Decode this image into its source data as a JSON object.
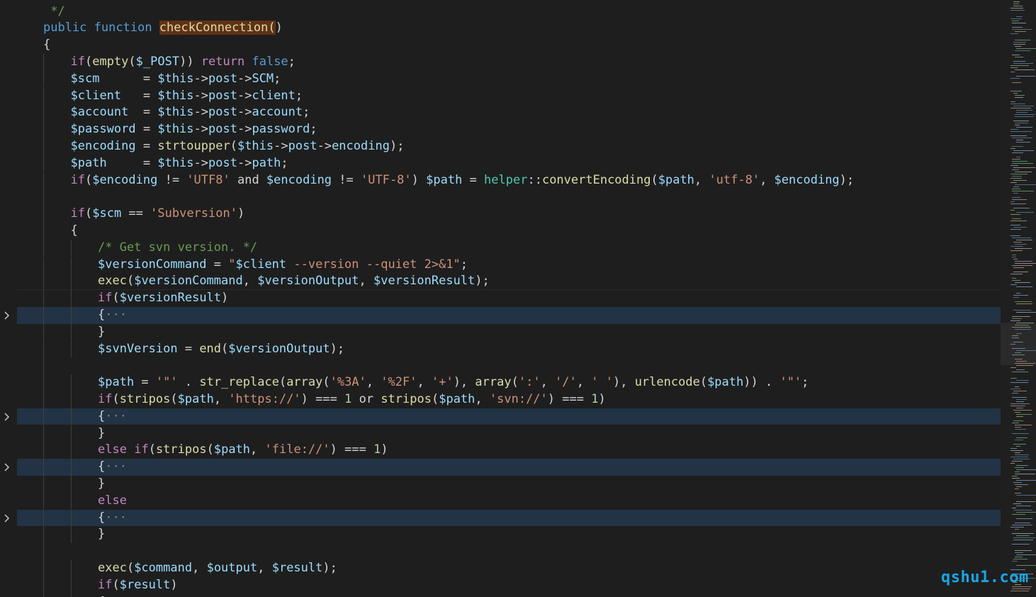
{
  "editor": {
    "language": "php",
    "colors": {
      "background": "#1e1e1e",
      "folded_line_bg": "#213344",
      "keyword": "#569cd6",
      "control": "#c586c0",
      "variable": "#9cdcfe",
      "function": "#dcdcaa",
      "string": "#ce9178",
      "comment": "#6a9955",
      "number": "#b5cea8",
      "class": "#4ec9b0"
    },
    "lines": [
      {
        "indent": 1,
        "tokens": [
          [
            "cmt",
            " */"
          ]
        ]
      },
      {
        "indent": 1,
        "tokens": [
          [
            "kw",
            "public"
          ],
          [
            "op",
            " "
          ],
          [
            "kw",
            "function"
          ],
          [
            "op",
            " "
          ],
          [
            "hlfn",
            "checkConnection("
          ],
          [
            "punc",
            ")"
          ]
        ]
      },
      {
        "indent": 1,
        "tokens": [
          [
            "punc",
            "{"
          ]
        ]
      },
      {
        "indent": 2,
        "tokens": [
          [
            "ctl",
            "if"
          ],
          [
            "punc",
            "("
          ],
          [
            "fn",
            "empty"
          ],
          [
            "punc",
            "("
          ],
          [
            "var",
            "$_POST"
          ],
          [
            "punc",
            ")) "
          ],
          [
            "ctl",
            "return"
          ],
          [
            "op",
            " "
          ],
          [
            "kw",
            "false"
          ],
          [
            "punc",
            ";"
          ]
        ]
      },
      {
        "indent": 2,
        "tokens": [
          [
            "var",
            "$scm"
          ],
          [
            "op",
            "      = "
          ],
          [
            "var",
            "$this"
          ],
          [
            "op",
            "->"
          ],
          [
            "var",
            "post"
          ],
          [
            "op",
            "->"
          ],
          [
            "var",
            "SCM"
          ],
          [
            "punc",
            ";"
          ]
        ]
      },
      {
        "indent": 2,
        "tokens": [
          [
            "var",
            "$client"
          ],
          [
            "op",
            "   = "
          ],
          [
            "var",
            "$this"
          ],
          [
            "op",
            "->"
          ],
          [
            "var",
            "post"
          ],
          [
            "op",
            "->"
          ],
          [
            "var",
            "client"
          ],
          [
            "punc",
            ";"
          ]
        ]
      },
      {
        "indent": 2,
        "tokens": [
          [
            "var",
            "$account"
          ],
          [
            "op",
            "  = "
          ],
          [
            "var",
            "$this"
          ],
          [
            "op",
            "->"
          ],
          [
            "var",
            "post"
          ],
          [
            "op",
            "->"
          ],
          [
            "var",
            "account"
          ],
          [
            "punc",
            ";"
          ]
        ]
      },
      {
        "indent": 2,
        "tokens": [
          [
            "var",
            "$password"
          ],
          [
            "op",
            " = "
          ],
          [
            "var",
            "$this"
          ],
          [
            "op",
            "->"
          ],
          [
            "var",
            "post"
          ],
          [
            "op",
            "->"
          ],
          [
            "var",
            "password"
          ],
          [
            "punc",
            ";"
          ]
        ]
      },
      {
        "indent": 2,
        "tokens": [
          [
            "var",
            "$encoding"
          ],
          [
            "op",
            " = "
          ],
          [
            "fn",
            "strtoupper"
          ],
          [
            "punc",
            "("
          ],
          [
            "var",
            "$this"
          ],
          [
            "op",
            "->"
          ],
          [
            "var",
            "post"
          ],
          [
            "op",
            "->"
          ],
          [
            "var",
            "encoding"
          ],
          [
            "punc",
            ");"
          ]
        ]
      },
      {
        "indent": 2,
        "tokens": [
          [
            "var",
            "$path"
          ],
          [
            "op",
            "     = "
          ],
          [
            "var",
            "$this"
          ],
          [
            "op",
            "->"
          ],
          [
            "var",
            "post"
          ],
          [
            "op",
            "->"
          ],
          [
            "var",
            "path"
          ],
          [
            "punc",
            ";"
          ]
        ]
      },
      {
        "indent": 2,
        "tokens": [
          [
            "ctl",
            "if"
          ],
          [
            "punc",
            "("
          ],
          [
            "var",
            "$encoding"
          ],
          [
            "op",
            " != "
          ],
          [
            "str",
            "'UTF8'"
          ],
          [
            "op",
            " and "
          ],
          [
            "var",
            "$encoding"
          ],
          [
            "op",
            " != "
          ],
          [
            "str",
            "'UTF-8'"
          ],
          [
            "punc",
            ") "
          ],
          [
            "var",
            "$path"
          ],
          [
            "op",
            " = "
          ],
          [
            "cls",
            "helper"
          ],
          [
            "op",
            "::"
          ],
          [
            "fn",
            "convertEncoding"
          ],
          [
            "punc",
            "("
          ],
          [
            "var",
            "$path"
          ],
          [
            "punc",
            ", "
          ],
          [
            "str",
            "'utf-8'"
          ],
          [
            "punc",
            ", "
          ],
          [
            "var",
            "$encoding"
          ],
          [
            "punc",
            ");"
          ]
        ]
      },
      {
        "indent": 2,
        "tokens": []
      },
      {
        "indent": 2,
        "tokens": [
          [
            "ctl",
            "if"
          ],
          [
            "punc",
            "("
          ],
          [
            "var",
            "$scm"
          ],
          [
            "op",
            " == "
          ],
          [
            "str",
            "'Subversion'"
          ],
          [
            "punc",
            ")"
          ]
        ]
      },
      {
        "indent": 2,
        "tokens": [
          [
            "punc",
            "{"
          ]
        ]
      },
      {
        "indent": 3,
        "tokens": [
          [
            "cmt",
            "/* Get svn version. */"
          ]
        ]
      },
      {
        "indent": 3,
        "tokens": [
          [
            "var",
            "$versionCommand"
          ],
          [
            "op",
            " = "
          ],
          [
            "str",
            "\""
          ],
          [
            "var",
            "$client"
          ],
          [
            "str",
            " --version --quiet 2>&1\""
          ],
          [
            "punc",
            ";"
          ]
        ]
      },
      {
        "indent": 3,
        "tokens": [
          [
            "fn",
            "exec"
          ],
          [
            "punc",
            "("
          ],
          [
            "var",
            "$versionCommand"
          ],
          [
            "punc",
            ", "
          ],
          [
            "var",
            "$versionOutput"
          ],
          [
            "punc",
            ", "
          ],
          [
            "var",
            "$versionResult"
          ],
          [
            "punc",
            ");"
          ]
        ]
      },
      {
        "indent": 3,
        "tokens": [
          [
            "ctl",
            "if"
          ],
          [
            "punc",
            "("
          ],
          [
            "var",
            "$versionResult"
          ],
          [
            "punc",
            ")"
          ]
        ]
      },
      {
        "indent": 3,
        "folded": true,
        "tokens": [
          [
            "punc",
            "{"
          ],
          [
            "fold",
            "···"
          ]
        ]
      },
      {
        "indent": 3,
        "tokens": [
          [
            "punc",
            "}"
          ]
        ]
      },
      {
        "indent": 3,
        "tokens": [
          [
            "var",
            "$svnVersion"
          ],
          [
            "op",
            " = "
          ],
          [
            "fn",
            "end"
          ],
          [
            "punc",
            "("
          ],
          [
            "var",
            "$versionOutput"
          ],
          [
            "punc",
            ");"
          ]
        ]
      },
      {
        "indent": 3,
        "tokens": []
      },
      {
        "indent": 3,
        "tokens": [
          [
            "var",
            "$path"
          ],
          [
            "op",
            " = "
          ],
          [
            "str",
            "'\"'"
          ],
          [
            "op",
            " . "
          ],
          [
            "fn",
            "str_replace"
          ],
          [
            "punc",
            "("
          ],
          [
            "fn",
            "array"
          ],
          [
            "punc",
            "("
          ],
          [
            "str",
            "'%3A'"
          ],
          [
            "punc",
            ", "
          ],
          [
            "str",
            "'%2F'"
          ],
          [
            "punc",
            ", "
          ],
          [
            "str",
            "'+'"
          ],
          [
            "punc",
            "), "
          ],
          [
            "fn",
            "array"
          ],
          [
            "punc",
            "("
          ],
          [
            "str",
            "':'"
          ],
          [
            "punc",
            ", "
          ],
          [
            "str",
            "'/'"
          ],
          [
            "punc",
            ", "
          ],
          [
            "str",
            "' '"
          ],
          [
            "punc",
            "), "
          ],
          [
            "fn",
            "urlencode"
          ],
          [
            "punc",
            "("
          ],
          [
            "var",
            "$path"
          ],
          [
            "punc",
            ")) "
          ],
          [
            "op",
            ". "
          ],
          [
            "str",
            "'\"'"
          ],
          [
            "punc",
            ";"
          ]
        ]
      },
      {
        "indent": 3,
        "tokens": [
          [
            "ctl",
            "if"
          ],
          [
            "punc",
            "("
          ],
          [
            "fn",
            "stripos"
          ],
          [
            "punc",
            "("
          ],
          [
            "var",
            "$path"
          ],
          [
            "punc",
            ", "
          ],
          [
            "str",
            "'https://'"
          ],
          [
            "punc",
            ")"
          ],
          [
            "op",
            " === "
          ],
          [
            "num",
            "1"
          ],
          [
            "op",
            " or "
          ],
          [
            "fn",
            "stripos"
          ],
          [
            "punc",
            "("
          ],
          [
            "var",
            "$path"
          ],
          [
            "punc",
            ", "
          ],
          [
            "str",
            "'svn://'"
          ],
          [
            "punc",
            ")"
          ],
          [
            "op",
            " === "
          ],
          [
            "num",
            "1"
          ],
          [
            "punc",
            ")"
          ]
        ]
      },
      {
        "indent": 3,
        "folded": true,
        "tokens": [
          [
            "punc",
            "{"
          ],
          [
            "fold",
            "···"
          ]
        ]
      },
      {
        "indent": 3,
        "tokens": [
          [
            "punc",
            "}"
          ]
        ]
      },
      {
        "indent": 3,
        "tokens": [
          [
            "ctl",
            "else"
          ],
          [
            "op",
            " "
          ],
          [
            "ctl",
            "if"
          ],
          [
            "punc",
            "("
          ],
          [
            "fn",
            "stripos"
          ],
          [
            "punc",
            "("
          ],
          [
            "var",
            "$path"
          ],
          [
            "punc",
            ", "
          ],
          [
            "str",
            "'file://'"
          ],
          [
            "punc",
            ")"
          ],
          [
            "op",
            " === "
          ],
          [
            "num",
            "1"
          ],
          [
            "punc",
            ")"
          ]
        ]
      },
      {
        "indent": 3,
        "folded": true,
        "tokens": [
          [
            "punc",
            "{"
          ],
          [
            "fold",
            "···"
          ]
        ]
      },
      {
        "indent": 3,
        "tokens": [
          [
            "punc",
            "}"
          ]
        ]
      },
      {
        "indent": 3,
        "tokens": [
          [
            "ctl",
            "else"
          ]
        ]
      },
      {
        "indent": 3,
        "folded": true,
        "tokens": [
          [
            "punc",
            "{"
          ],
          [
            "fold",
            "···"
          ]
        ]
      },
      {
        "indent": 3,
        "tokens": [
          [
            "punc",
            "}"
          ]
        ]
      },
      {
        "indent": 3,
        "tokens": []
      },
      {
        "indent": 3,
        "tokens": [
          [
            "fn",
            "exec"
          ],
          [
            "punc",
            "("
          ],
          [
            "var",
            "$command"
          ],
          [
            "punc",
            ", "
          ],
          [
            "var",
            "$output"
          ],
          [
            "punc",
            ", "
          ],
          [
            "var",
            "$result"
          ],
          [
            "punc",
            ");"
          ]
        ]
      },
      {
        "indent": 3,
        "tokens": [
          [
            "ctl",
            "if"
          ],
          [
            "punc",
            "("
          ],
          [
            "var",
            "$result"
          ],
          [
            "punc",
            ")"
          ]
        ]
      },
      {
        "indent": 3,
        "tokens": [
          [
            "punc",
            "{"
          ]
        ]
      }
    ]
  },
  "watermark": "qshu1.com"
}
